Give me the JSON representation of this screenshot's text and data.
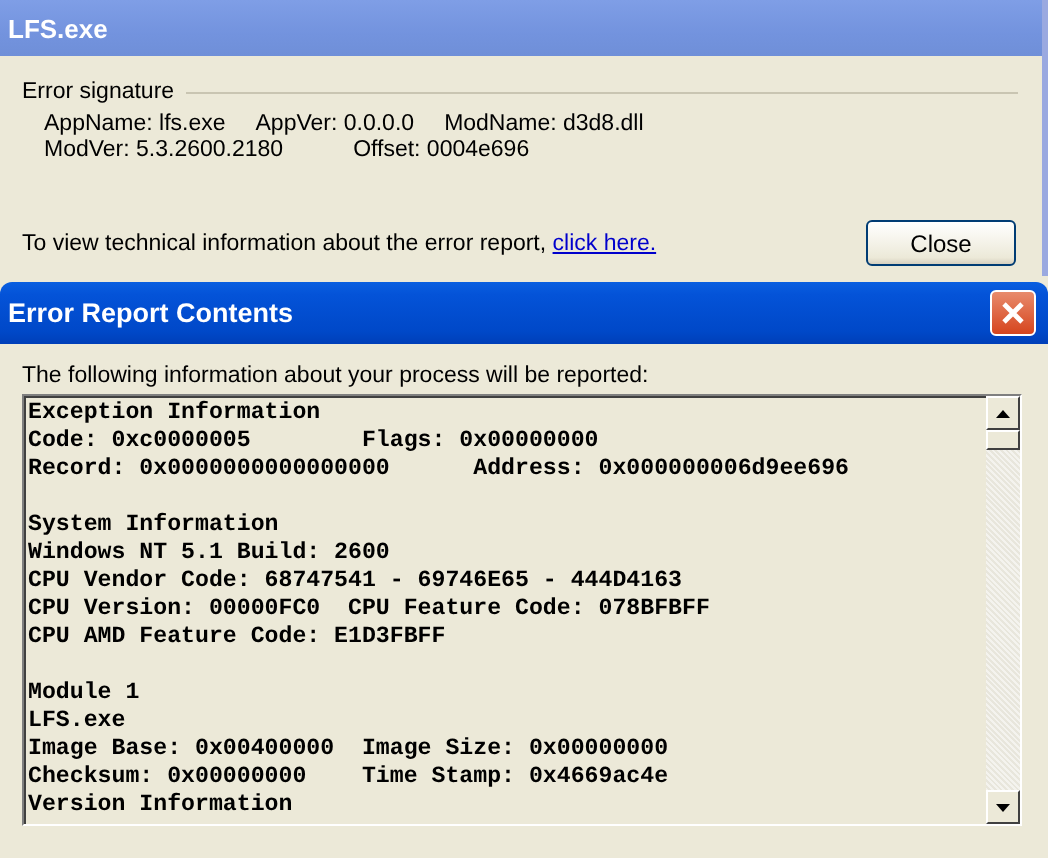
{
  "window": {
    "title": "LFS.exe"
  },
  "signature": {
    "heading": "Error signature",
    "rows": [
      [
        "AppName: lfs.exe",
        "AppVer: 0.0.0.0",
        "ModName: d3d8.dll"
      ],
      [
        "ModVer: 5.3.2600.2180",
        "Offset: 0004e696"
      ]
    ]
  },
  "tech_info": {
    "text": "To view technical information about the error report,",
    "link": "click here."
  },
  "buttons": [
    "Close"
  ],
  "report_window": {
    "title": "Error Report Contents",
    "intro": "The following information about your process will be reported:",
    "sections": [
      {
        "lines": [
          "Exception Information",
          "Code: 0xc0000005        Flags: 0x00000000",
          "Record: 0x0000000000000000      Address: 0x000000006d9ee696"
        ]
      },
      {
        "lines": [
          "System Information",
          "Windows NT 5.1 Build: 2600",
          "CPU Vendor Code: 68747541 - 69746E65 - 444D4163",
          "CPU Version: 00000FC0  CPU Feature Code: 078BFBFF",
          "CPU AMD Feature Code: E1D3FBFF"
        ]
      },
      {
        "lines": [
          "Module 1",
          "LFS.exe",
          "Image Base: 0x00400000  Image Size: 0x00000000",
          "Checksum: 0x00000000    Time Stamp: 0x4669ac4e",
          "Version Information"
        ]
      }
    ]
  }
}
